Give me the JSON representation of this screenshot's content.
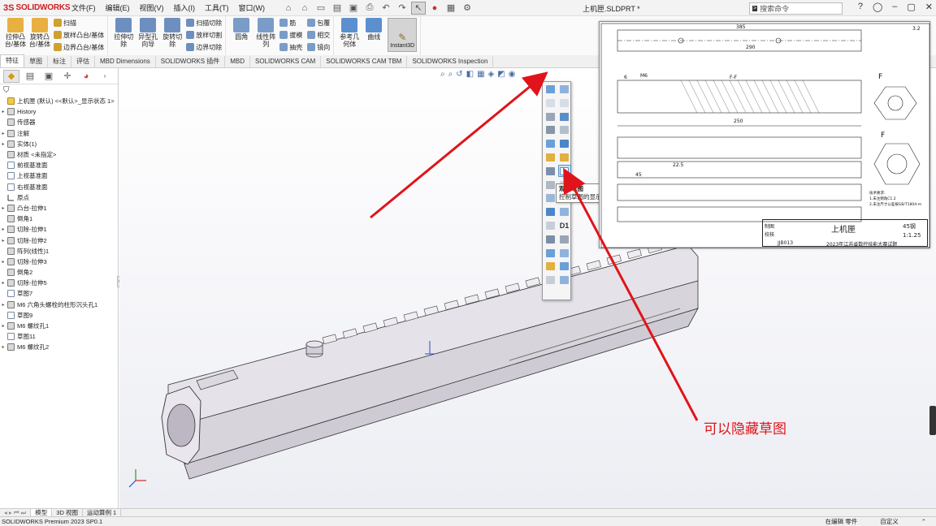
{
  "app": {
    "logo_ds": "3S",
    "logo_name": "SOLIDWORKS",
    "file_title": "上机匣.SLDPRT *",
    "search_placeholder": "搜索命令"
  },
  "menu": [
    {
      "label": "文件(F)"
    },
    {
      "label": "编辑(E)"
    },
    {
      "label": "视图(V)"
    },
    {
      "label": "插入(I)"
    },
    {
      "label": "工具(T)"
    },
    {
      "label": "窗口(W)"
    }
  ],
  "ribbon": {
    "g1": [
      {
        "label": "拉伸凸台/基体",
        "color": "#e8b040"
      },
      {
        "label": "旋转凸台/基体",
        "color": "#e8b040"
      }
    ],
    "g1_small": [
      {
        "label": "扫描",
        "color": "#d0a030"
      },
      {
        "label": "放样凸台/基体",
        "color": "#d0a030"
      },
      {
        "label": "边界凸台/基体",
        "color": "#d0a030"
      }
    ],
    "g2": [
      {
        "label": "拉伸切除",
        "color": "#6d8fc0"
      },
      {
        "label": "异型孔向导",
        "color": "#6d8fc0"
      },
      {
        "label": "旋转切除",
        "color": "#6d8fc0"
      }
    ],
    "g2_small": [
      {
        "label": "扫描切除",
        "color": "#6d8fc0"
      },
      {
        "label": "放样切割",
        "color": "#6d8fc0"
      },
      {
        "label": "边界切除",
        "color": "#6d8fc0"
      }
    ],
    "g3": [
      {
        "label": "圆角",
        "color": "#7a9cc8"
      },
      {
        "label": "线性阵列",
        "color": "#7a9cc8"
      }
    ],
    "g3_small": [
      {
        "label": "筋",
        "color": "#7a9cc8"
      },
      {
        "label": "拔模",
        "color": "#7a9cc8"
      },
      {
        "label": "抽壳",
        "color": "#7a9cc8"
      }
    ],
    "g3_small2": [
      {
        "label": "包覆",
        "color": "#7a9cc8"
      },
      {
        "label": "相交",
        "color": "#7a9cc8"
      },
      {
        "label": "镜向",
        "color": "#7a9cc8"
      }
    ],
    "g4": [
      {
        "label": "参考几何体",
        "color": "#5b8fd0"
      },
      {
        "label": "曲线",
        "color": "#5b8fd0"
      }
    ],
    "instant3d": "Instant3D"
  },
  "tabs": [
    {
      "label": "特征",
      "active": true
    },
    {
      "label": "草图"
    },
    {
      "label": "标注"
    },
    {
      "label": "评估"
    },
    {
      "label": "MBD Dimensions"
    },
    {
      "label": "SOLIDWORKS 插件"
    },
    {
      "label": "MBD"
    },
    {
      "label": "SOLIDWORKS CAM"
    },
    {
      "label": "SOLIDWORKS CAM TBM"
    },
    {
      "label": "SOLIDWORKS Inspection"
    }
  ],
  "tree": [
    {
      "label": "上机匣 (默认) <<默认>_显示状态 1>",
      "arrow": "",
      "icon": "part"
    },
    {
      "label": "History",
      "arrow": "▸",
      "icon": "feat"
    },
    {
      "label": "传感器",
      "arrow": "",
      "icon": "feat"
    },
    {
      "label": "注解",
      "arrow": "▸",
      "icon": "feat"
    },
    {
      "label": "实体(1)",
      "arrow": "▸",
      "icon": "feat"
    },
    {
      "label": "材质 <未指定>",
      "arrow": "",
      "icon": "feat"
    },
    {
      "label": "前视基准面",
      "arrow": "",
      "icon": "plane"
    },
    {
      "label": "上视基准面",
      "arrow": "",
      "icon": "plane"
    },
    {
      "label": "右视基准面",
      "arrow": "",
      "icon": "plane"
    },
    {
      "label": "原点",
      "arrow": "",
      "icon": "origin"
    },
    {
      "label": "凸台-拉伸1",
      "arrow": "▸",
      "icon": "feat"
    },
    {
      "label": "倒角1",
      "arrow": "",
      "icon": "feat"
    },
    {
      "label": "切除-拉伸1",
      "arrow": "▸",
      "icon": "feat"
    },
    {
      "label": "切除-拉伸2",
      "arrow": "▸",
      "icon": "feat"
    },
    {
      "label": "阵列(线性)1",
      "arrow": "",
      "icon": "feat"
    },
    {
      "label": "切除-拉伸3",
      "arrow": "▸",
      "icon": "feat"
    },
    {
      "label": "倒角2",
      "arrow": "",
      "icon": "feat"
    },
    {
      "label": "切除-拉伸5",
      "arrow": "▸",
      "icon": "feat"
    },
    {
      "label": "草图7",
      "arrow": "",
      "icon": "plane"
    },
    {
      "label": "M6 六角头螺栓的柱形沉头孔1",
      "arrow": "▸",
      "icon": "feat"
    },
    {
      "label": "草图9",
      "arrow": "",
      "icon": "plane"
    },
    {
      "label": "M6 螺纹孔1",
      "arrow": "▸",
      "icon": "feat"
    },
    {
      "label": "草图11",
      "arrow": "",
      "icon": "plane"
    },
    {
      "label": "M6 螺纹孔2",
      "arrow": "▸",
      "icon": "feat"
    }
  ],
  "popup_toolbar": {
    "d1_label": "D1"
  },
  "tooltip": {
    "title": "观阅草图",
    "body": "控制草图的显示状态。"
  },
  "drawing": {
    "part_name": "上机匣",
    "material": "45钢",
    "scale": "1:1.25",
    "code": "JJB013",
    "school": "2023年江苏省数控技能大赛试题",
    "label_design": "制图",
    "label_check": "校核",
    "notes": "技术要求:\n1.未注倒角C1.2\n2.未注尺寸公差按GB/T1804-m",
    "dims": [
      "385",
      "290",
      "250",
      "22.5",
      "45",
      "6",
      "F",
      "F-F",
      "M6",
      "3.2"
    ]
  },
  "annotation": {
    "text": "可以隐藏草图",
    "color": "#e0141a"
  },
  "bottom_tabs": [
    {
      "label": "模型",
      "active": true
    },
    {
      "label": "3D 视图"
    },
    {
      "label": "运动算例 1"
    }
  ],
  "status": {
    "left": "SOLIDWORKS Premium 2023 SP0.1",
    "editing": "在编辑 零件",
    "custom": "自定义"
  }
}
